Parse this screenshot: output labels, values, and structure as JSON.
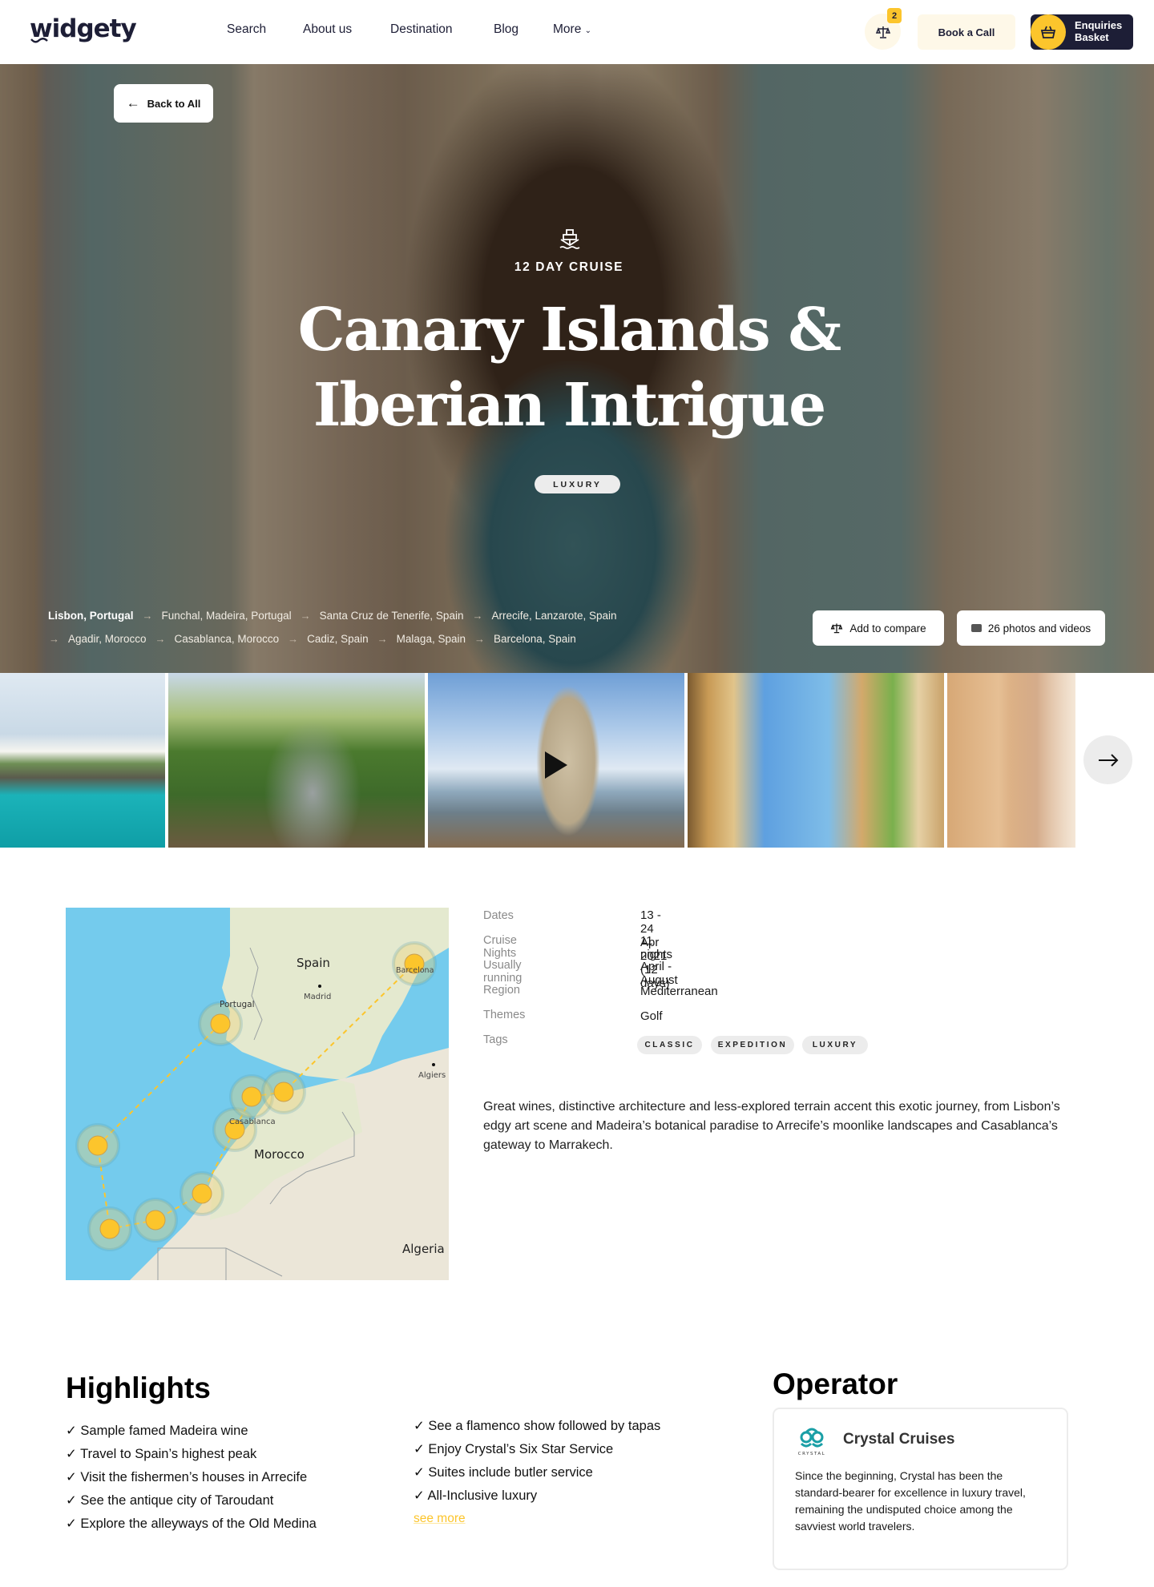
{
  "header": {
    "logo": "widgety",
    "nav": [
      {
        "label": "Search"
      },
      {
        "label": "About us"
      },
      {
        "label": "Destination"
      },
      {
        "label": "Blog"
      },
      {
        "label": "More"
      }
    ],
    "compare_count": "2",
    "book_call": "Book a Call",
    "basket_line1": "Enquiries",
    "basket_line2": "Basket",
    "colors": {
      "accent": "#fcc52c",
      "navy": "#1d1e36",
      "cream": "#fef8e8"
    }
  },
  "hero": {
    "back_label": "Back to All",
    "cruise_length": "12 DAY CRUISE",
    "title_line1": "Canary Islands &",
    "title_line2": "Iberian Intrigue",
    "tag": "LUXURY",
    "route_row1": [
      "Lisbon, Portugal",
      "Funchal, Madeira, Portugal",
      "Santa Cruz de Tenerife, Spain",
      "Arrecife, Lanzarote, Spain"
    ],
    "route_row2": [
      "Agadir, Morocco",
      "Casablanca, Morocco",
      "Cadiz, Spain",
      "Malaga, Spain",
      "Barcelona, Spain"
    ],
    "add_compare": "Add to compare",
    "media_count": "26 photos and videos"
  },
  "gallery": {
    "photos": [
      {
        "alt": "Arrecife waterfront"
      },
      {
        "alt": "Madeira botanical garden"
      },
      {
        "alt": "Belem Tower, Lisbon"
      },
      {
        "alt": "Plaza de Espana, Seville"
      },
      {
        "alt": "Moroccan courtyard"
      }
    ]
  },
  "map": {
    "labels": {
      "spain": "Spain",
      "madrid": "Madrid",
      "portugal": "Portugal",
      "barcelona": "Barcelona",
      "algiers": "Algiers",
      "casablanca": "Casablanca",
      "morocco": "Morocco",
      "algeria": "Algeria"
    }
  },
  "details": {
    "rows": [
      {
        "label": "Dates",
        "value": "13 - 24 Apr 2021 (12 days)"
      },
      {
        "label": "Cruise Nights",
        "value": "11 nights"
      },
      {
        "label": "Usually running",
        "value": "April - August"
      },
      {
        "label": "Region",
        "value": "Mediterranean"
      },
      {
        "label": "Themes",
        "value": "Golf"
      },
      {
        "label": "Tags",
        "value": ""
      }
    ],
    "tags": [
      "CLASSIC",
      "EXPEDITION",
      "LUXURY"
    ],
    "description": "Great wines, distinctive architecture and less-explored terrain accent this exotic journey, from Lisbon’s edgy art scene and Madeira’s botanical paradise to Arrecife’s moonlike landscapes and Casablanca’s gateway to Marrakech."
  },
  "highlights": {
    "title": "Highlights",
    "col1": [
      "✓ Sample famed Madeira wine",
      "✓ Travel to Spain’s highest peak",
      "✓ Visit the fishermen’s houses in Arrecife",
      "✓ See the antique city of Taroudant",
      "✓ Explore the alleyways of the Old Medina"
    ],
    "col2": [
      "✓ See a flamenco show followed by tapas",
      "✓ Enjoy Crystal’s Six Star Service",
      "✓ Suites include butler service",
      "✓ All-Inclusive luxury"
    ],
    "see_more": "see more"
  },
  "operator": {
    "title": "Operator",
    "name": "Crystal Cruises",
    "logo_text": "CRYSTAL",
    "description": "Since the beginning, Crystal has been the standard-bearer for excellence in luxury travel, remaining the undisputed choice among the savviest world travelers."
  }
}
